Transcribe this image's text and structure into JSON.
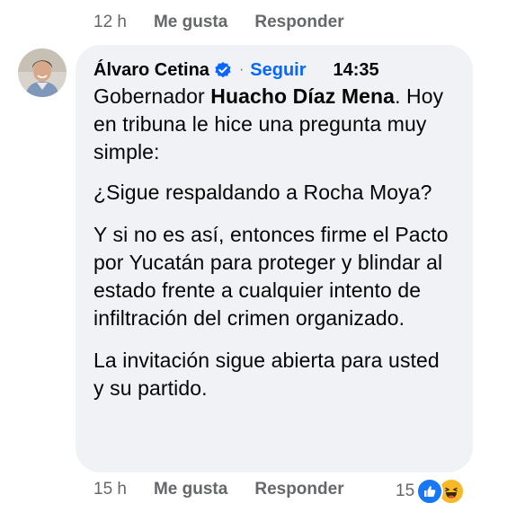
{
  "top_meta": {
    "time": "12 h",
    "like_label": "Me gusta",
    "reply_label": "Responder"
  },
  "comment": {
    "author": "Álvaro Cetina",
    "separator": "·",
    "follow_label": "Seguir",
    "time": "14:35",
    "text": {
      "p1_prefix": "Gobernador ",
      "p1_bold": "Huacho Díaz Mena",
      "p1_suffix": ". Hoy en tribuna le hice una pregunta muy simple:",
      "p2": "¿Sigue respaldando a Rocha Moya?",
      "p3": "Y si no es así, entonces firme el Pacto por Yucatán para proteger y blindar al estado frente a cualquier intento de infiltración del crimen organizado.",
      "p4": "La invitación sigue abierta para usted y su partido."
    }
  },
  "bottom_meta": {
    "time": "15 h",
    "like_label": "Me gusta",
    "reply_label": "Responder",
    "reaction_count": "15",
    "reactions": [
      "like-icon",
      "haha-icon"
    ]
  },
  "colors": {
    "bubble": "#f0f2f5",
    "link": "#0866ff",
    "muted": "#65676b",
    "like": "#1877f2",
    "haha": "#f7b928"
  }
}
